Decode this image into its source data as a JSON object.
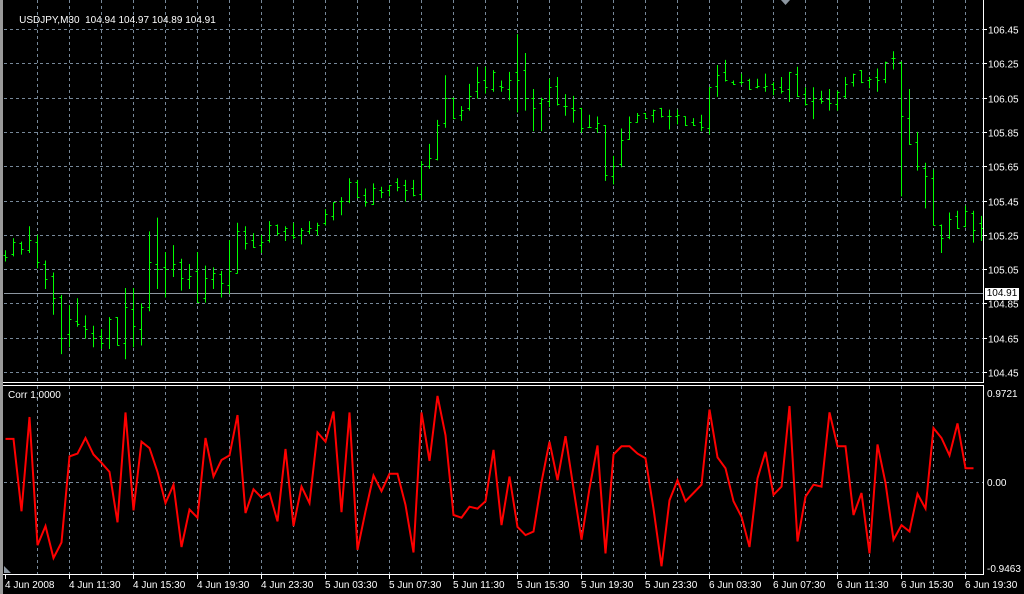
{
  "header": {
    "symbol": "USDJPY,M30",
    "open": "104.94",
    "high": "104.97",
    "low": "104.89",
    "close": "104.91"
  },
  "current_price_label": "104.91",
  "colors": {
    "background": "#000000",
    "grid": "#778899",
    "bars": "#00ff00",
    "indicator": "#ff0000",
    "bid_line": "#8c96a0",
    "axis": "#ffffff"
  },
  "chart_data": [
    {
      "type": "ohlc",
      "title": "USDJPY,M30",
      "ylim": [
        104.4,
        106.55
      ],
      "y_ticks": [
        "106.45",
        "106.25",
        "106.05",
        "105.85",
        "105.65",
        "105.45",
        "105.25",
        "105.05",
        "104.85",
        "104.65",
        "104.45"
      ],
      "x_ticks": [
        "4 Jun 2008",
        "4 Jun 11:30",
        "4 Jun 15:30",
        "4 Jun 19:30",
        "4 Jun 23:30",
        "5 Jun 03:30",
        "5 Jun 07:30",
        "5 Jun 11:30",
        "5 Jun 15:30",
        "5 Jun 19:30",
        "5 Jun 23:30",
        "6 Jun 03:30",
        "6 Jun 07:30",
        "6 Jun 11:30",
        "6 Jun 15:30",
        "6 Jun 19:30"
      ],
      "grid": true,
      "bid_line": 104.91,
      "bars_ohlc": [
        [
          105.13,
          105.16,
          105.1,
          105.12
        ],
        [
          105.14,
          105.23,
          105.13,
          105.21
        ],
        [
          105.2,
          105.21,
          105.14,
          105.17
        ],
        [
          105.16,
          105.3,
          105.15,
          105.22
        ],
        [
          105.21,
          105.25,
          105.06,
          105.09
        ],
        [
          105.08,
          105.1,
          104.94,
          104.99
        ],
        [
          105.01,
          105.03,
          104.79,
          104.88
        ],
        [
          104.89,
          104.9,
          104.56,
          104.65
        ],
        [
          104.67,
          104.84,
          104.6,
          104.76
        ],
        [
          104.75,
          104.88,
          104.72,
          104.73
        ],
        [
          104.72,
          104.78,
          104.65,
          104.7
        ],
        [
          104.68,
          104.72,
          104.6,
          104.65
        ],
        [
          104.66,
          104.7,
          104.59,
          104.62
        ],
        [
          104.65,
          104.77,
          104.59,
          104.76
        ],
        [
          104.77,
          104.77,
          104.61,
          104.61
        ],
        [
          104.62,
          104.94,
          104.53,
          104.83
        ],
        [
          104.82,
          104.94,
          104.6,
          104.72
        ],
        [
          104.7,
          104.85,
          104.61,
          104.83
        ],
        [
          104.83,
          105.27,
          104.81,
          105.09
        ],
        [
          105.08,
          105.35,
          104.94,
          105.05
        ],
        [
          105.06,
          105.15,
          104.89,
          105.05
        ],
        [
          105.05,
          105.19,
          105.01,
          105.08
        ],
        [
          105.09,
          105.11,
          104.93,
          105.0
        ],
        [
          104.99,
          105.08,
          104.94,
          105.01
        ],
        [
          105.04,
          105.15,
          104.86,
          104.86
        ],
        [
          104.88,
          105.07,
          104.86,
          105.0
        ],
        [
          104.99,
          105.06,
          104.94,
          105.03
        ],
        [
          105.02,
          105.04,
          104.89,
          104.97
        ],
        [
          104.96,
          105.22,
          104.91,
          105.04
        ],
        [
          105.03,
          105.32,
          105.03,
          105.27
        ],
        [
          105.27,
          105.3,
          105.17,
          105.2
        ],
        [
          105.22,
          105.26,
          105.18,
          105.18
        ],
        [
          105.19,
          105.25,
          105.15,
          105.21
        ],
        [
          105.22,
          105.33,
          105.21,
          105.31
        ],
        [
          105.31,
          105.31,
          105.25,
          105.26
        ],
        [
          105.27,
          105.3,
          105.22,
          105.29
        ],
        [
          105.25,
          105.32,
          105.23,
          105.24
        ],
        [
          105.25,
          105.29,
          105.2,
          105.28
        ],
        [
          105.27,
          105.33,
          105.26,
          105.29
        ],
        [
          105.28,
          105.32,
          105.25,
          105.31
        ],
        [
          105.32,
          105.4,
          105.31,
          105.37
        ],
        [
          105.36,
          105.44,
          105.34,
          105.44
        ],
        [
          105.45,
          105.47,
          105.37,
          105.45
        ],
        [
          105.45,
          105.58,
          105.44,
          105.56
        ],
        [
          105.56,
          105.57,
          105.47,
          105.47
        ],
        [
          105.48,
          105.52,
          105.42,
          105.44
        ],
        [
          105.43,
          105.55,
          105.43,
          105.52
        ],
        [
          105.51,
          105.53,
          105.47,
          105.5
        ],
        [
          105.51,
          105.54,
          105.48,
          105.54
        ],
        [
          105.56,
          105.58,
          105.51,
          105.53
        ],
        [
          105.54,
          105.57,
          105.45,
          105.51
        ],
        [
          105.52,
          105.57,
          105.48,
          105.48
        ],
        [
          105.49,
          105.68,
          105.46,
          105.66
        ],
        [
          105.65,
          105.78,
          105.64,
          105.7
        ],
        [
          105.69,
          105.92,
          105.69,
          105.89
        ],
        [
          105.9,
          106.18,
          105.88,
          106.05
        ],
        [
          106.05,
          106.05,
          105.93,
          105.93
        ],
        [
          105.95,
          106.0,
          105.92,
          105.98
        ],
        [
          105.99,
          106.13,
          105.98,
          106.06
        ],
        [
          106.09,
          106.23,
          106.05,
          106.14
        ],
        [
          106.15,
          106.23,
          106.08,
          106.11
        ],
        [
          106.1,
          106.21,
          106.09,
          106.2
        ],
        [
          106.12,
          106.15,
          106.09,
          106.11
        ],
        [
          106.1,
          106.2,
          106.04,
          106.15
        ],
        [
          106.2,
          106.42,
          105.97,
          106.15
        ],
        [
          106.21,
          106.31,
          105.98,
          106.05
        ],
        [
          106.05,
          106.1,
          105.86,
          105.99
        ],
        [
          106.02,
          106.05,
          105.86,
          106.04
        ],
        [
          106.03,
          106.16,
          106.0,
          106.11
        ],
        [
          106.12,
          106.17,
          106.01,
          106.01
        ],
        [
          106.0,
          106.07,
          105.95,
          106.0
        ],
        [
          105.99,
          106.06,
          105.91,
          105.98
        ],
        [
          105.99,
          105.99,
          105.85,
          105.87
        ],
        [
          105.88,
          105.95,
          105.88,
          105.88
        ],
        [
          105.87,
          105.94,
          105.85,
          105.9
        ],
        [
          105.89,
          105.89,
          105.57,
          105.6
        ],
        [
          105.59,
          105.71,
          105.55,
          105.65
        ],
        [
          105.66,
          105.87,
          105.65,
          105.8
        ],
        [
          105.81,
          105.94,
          105.81,
          105.91
        ],
        [
          105.91,
          105.96,
          105.91,
          105.95
        ],
        [
          105.96,
          105.96,
          105.93,
          105.93
        ],
        [
          105.95,
          105.98,
          105.91,
          105.98
        ],
        [
          105.99,
          105.99,
          105.94,
          105.94
        ],
        [
          105.94,
          105.98,
          105.87,
          105.94
        ],
        [
          105.94,
          105.98,
          105.9,
          105.95
        ],
        [
          105.94,
          105.94,
          105.89,
          105.89
        ],
        [
          105.91,
          105.93,
          105.89,
          105.89
        ],
        [
          105.91,
          105.95,
          105.86,
          105.88
        ],
        [
          105.87,
          106.11,
          105.84,
          106.11
        ],
        [
          106.12,
          106.24,
          106.06,
          106.18
        ],
        [
          106.2,
          106.27,
          106.15,
          106.15
        ],
        [
          106.14,
          106.15,
          106.13,
          106.13
        ],
        [
          106.14,
          106.19,
          106.13,
          106.14
        ],
        [
          106.15,
          106.16,
          106.1,
          106.1
        ],
        [
          106.11,
          106.16,
          106.11,
          106.12
        ],
        [
          106.11,
          106.19,
          106.09,
          106.12
        ],
        [
          106.13,
          106.14,
          106.07,
          106.1
        ],
        [
          106.11,
          106.17,
          106.08,
          106.09
        ],
        [
          106.1,
          106.2,
          106.03,
          106.2
        ],
        [
          106.19,
          106.23,
          106.06,
          106.06
        ],
        [
          106.07,
          106.11,
          106.01,
          106.01
        ],
        [
          106.03,
          106.11,
          105.93,
          106.05
        ],
        [
          106.04,
          106.09,
          106.02,
          106.03
        ],
        [
          106.04,
          106.1,
          105.98,
          106.02
        ],
        [
          106.01,
          106.09,
          105.98,
          106.08
        ],
        [
          106.06,
          106.17,
          106.05,
          106.13
        ],
        [
          106.14,
          106.19,
          106.12,
          106.19
        ],
        [
          106.21,
          106.21,
          106.14,
          106.14
        ],
        [
          106.15,
          106.17,
          106.11,
          106.16
        ],
        [
          106.17,
          106.22,
          106.09,
          106.15
        ],
        [
          106.16,
          106.26,
          106.14,
          106.26
        ],
        [
          106.28,
          106.32,
          106.22,
          106.28
        ],
        [
          106.26,
          106.26,
          105.48,
          105.94
        ],
        [
          105.93,
          106.1,
          105.78,
          105.78
        ],
        [
          105.79,
          105.85,
          105.63,
          105.65
        ],
        [
          105.64,
          105.67,
          105.41,
          105.59
        ],
        [
          105.58,
          105.63,
          105.31,
          105.31
        ],
        [
          105.31,
          105.31,
          105.15,
          105.23
        ],
        [
          105.24,
          105.38,
          105.23,
          105.34
        ],
        [
          105.36,
          105.39,
          105.29,
          105.29
        ],
        [
          105.3,
          105.42,
          105.3,
          105.39
        ],
        [
          105.38,
          105.39,
          105.21,
          105.28
        ],
        [
          105.32,
          105.36,
          105.22,
          105.29
        ]
      ]
    },
    {
      "type": "line",
      "title": "Corr 1,0000",
      "ylim": [
        -0.9463,
        0.9721
      ],
      "y_ticks": [
        "0.9721",
        "0.00",
        "-0.9463"
      ],
      "grid": true,
      "series": [
        {
          "name": "Corr",
          "values": [
            0.47,
            0.47,
            -0.32,
            0.71,
            -0.69,
            -0.48,
            -0.83,
            -0.66,
            0.28,
            0.31,
            0.48,
            0.3,
            0.21,
            0.11,
            -0.44,
            0.76,
            -0.31,
            0.44,
            0.37,
            0.11,
            -0.23,
            -0.03,
            -0.71,
            -0.3,
            -0.39,
            0.48,
            0.06,
            0.24,
            0.29,
            0.73,
            -0.34,
            -0.08,
            -0.17,
            -0.12,
            -0.43,
            0.36,
            -0.48,
            -0.05,
            -0.23,
            0.54,
            0.44,
            0.77,
            -0.33,
            0.76,
            -0.74,
            -0.32,
            0.07,
            -0.1,
            0.09,
            0.09,
            -0.25,
            -0.77,
            0.76,
            0.23,
            0.94,
            0.51,
            -0.36,
            -0.39,
            -0.27,
            -0.29,
            -0.21,
            0.35,
            -0.47,
            0.06,
            -0.49,
            -0.58,
            -0.54,
            0.0,
            0.44,
            0.02,
            0.5,
            -0.07,
            -0.63,
            -0.07,
            0.4,
            -0.78,
            0.3,
            0.39,
            0.39,
            0.31,
            0.26,
            -0.29,
            -0.92,
            -0.2,
            0.02,
            -0.21,
            -0.12,
            -0.03,
            0.79,
            0.27,
            0.15,
            -0.21,
            -0.38,
            -0.71,
            0.04,
            0.33,
            -0.14,
            -0.05,
            0.83,
            -0.65,
            -0.16,
            -0.03,
            -0.05,
            0.76,
            0.39,
            0.39,
            -0.36,
            -0.12,
            -0.78,
            0.41,
            -0.01,
            -0.63,
            -0.47,
            -0.54,
            -0.13,
            -0.29,
            0.59,
            0.48,
            0.29,
            0.64,
            0.15,
            0.15
          ]
        }
      ]
    }
  ]
}
